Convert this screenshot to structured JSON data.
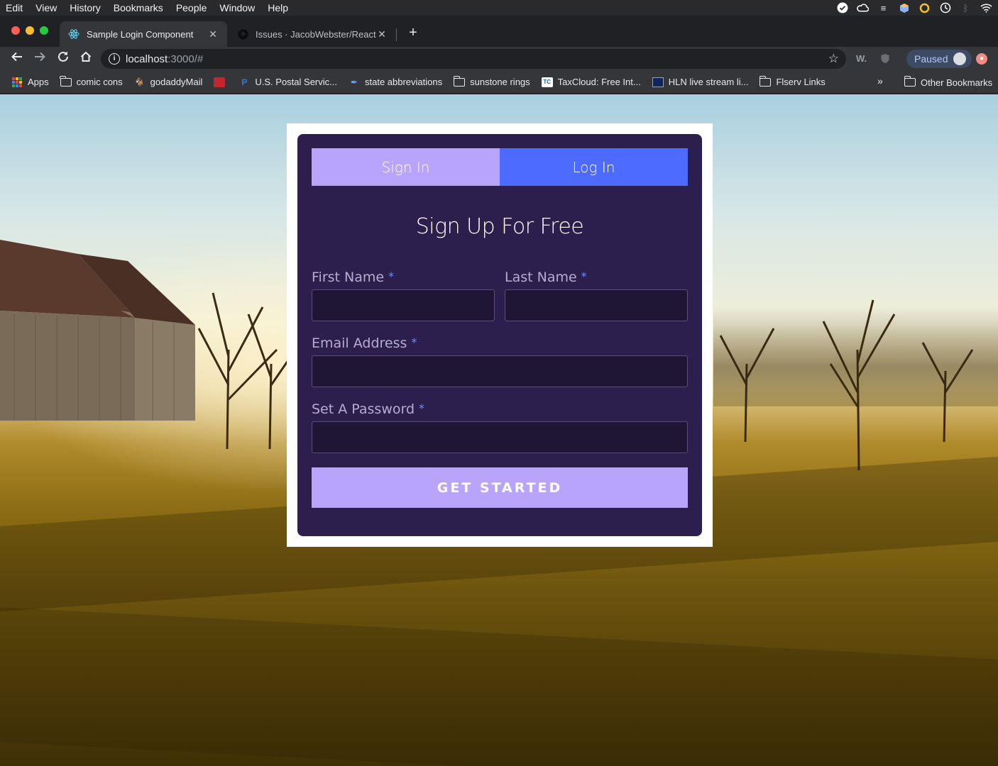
{
  "menubar": {
    "items": [
      "Edit",
      "View",
      "History",
      "Bookmarks",
      "People",
      "Window",
      "Help"
    ],
    "tray_icons": [
      "checkmark-icon",
      "creative-cloud-icon",
      "stack-icon",
      "box-icon",
      "sync-icon",
      "time-machine-icon",
      "bluetooth-icon",
      "wifi-icon"
    ]
  },
  "tabs": [
    {
      "title": "Sample Login Component",
      "icon": "react-icon",
      "active": true
    },
    {
      "title": "Issues · JacobWebster/React-L",
      "icon": "github-icon",
      "active": false
    }
  ],
  "toolbar": {
    "url_host": "localhost",
    "url_path": ":3000/#",
    "paused_label": "Paused"
  },
  "bookmarks": [
    {
      "label": "Apps",
      "icon": "apps-grid-icon"
    },
    {
      "label": "comic cons",
      "icon": "folder-icon"
    },
    {
      "label": "godaddyMail",
      "icon": "godaddy-icon"
    },
    {
      "label": "",
      "icon": "usps-logo-icon"
    },
    {
      "label": "U.S. Postal Servic...",
      "icon": "paypal-icon"
    },
    {
      "label": "state abbreviations",
      "icon": "feather-icon"
    },
    {
      "label": "sunstone rings",
      "icon": "folder-icon"
    },
    {
      "label": "TaxCloud: Free Int...",
      "icon": "taxcloud-icon"
    },
    {
      "label": "HLN live stream li...",
      "icon": "hln-icon"
    },
    {
      "label": "Flserv Links",
      "icon": "folder-icon"
    }
  ],
  "bookmarks_overflow": "»",
  "bookmarks_other": "Other Bookmarks",
  "form": {
    "tab_signin": "Sign In",
    "tab_login": "Log In",
    "title": "Sign Up For Free",
    "first_name_label": "First Name",
    "last_name_label": "Last Name",
    "email_label": "Email Address",
    "password_label": "Set A Password",
    "required_mark": "*",
    "submit_label": "GET STARTED"
  },
  "colors": {
    "card_bg": "#2c1f4d",
    "tab_signin_bg": "#b9a4fc",
    "tab_login_bg": "#4d6bff",
    "submit_bg": "#b9a4fc",
    "required_color": "#6c8dff"
  }
}
